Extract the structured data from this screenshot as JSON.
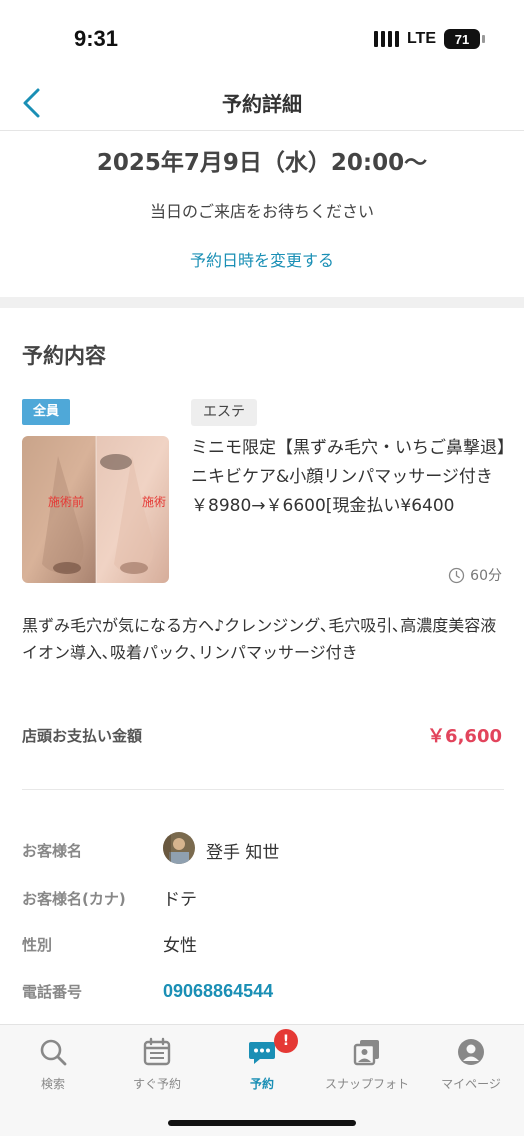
{
  "status_bar": {
    "time": "9:31",
    "network": "LTE",
    "battery": "71"
  },
  "nav": {
    "title": "予約詳細"
  },
  "reservation": {
    "date": "2025年7月9日（水）20:00〜",
    "message": "当日のご来店をお待ちください",
    "change_link": "予約日時を変更する"
  },
  "content": {
    "section_title": "予約内容",
    "tag_target": "全員",
    "tag_category": "エステ",
    "photo_labels": [
      "施術前",
      "施術"
    ],
    "menu_name": "ミニモ限定【黒ずみ毛穴・いちご鼻撃退】ニキビケア&小顔リンパマッサージ付き￥8980→￥6600[現金払い¥6400",
    "duration": "60分",
    "description": "黒ずみ毛穴が気になる方へ♪クレンジング､毛穴吸引､高濃度美容液イオン導入､吸着パック､リンパマッサージ付き",
    "payment_label": "店頭お支払い金額",
    "payment_value": "￥6,600"
  },
  "customer": {
    "name_label": "お客様名",
    "name_value": "登手 知世",
    "kana_label": "お客様名(カナ)",
    "kana_value": "ドテ",
    "gender_label": "性別",
    "gender_value": "女性",
    "phone_label": "電話番号",
    "phone_value": "09068864544"
  },
  "tabbar": {
    "items": [
      {
        "label": "検索",
        "icon": "search-icon"
      },
      {
        "label": "すぐ予約",
        "icon": "calendar-icon"
      },
      {
        "label": "予約",
        "icon": "chat-icon"
      },
      {
        "label": "スナップフォト",
        "icon": "photos-icon"
      },
      {
        "label": "マイページ",
        "icon": "user-icon"
      }
    ],
    "badge": "!"
  },
  "colors": {
    "accent": "#1a8fb5",
    "price": "#e2445c",
    "tag": "#4fa8d8",
    "badge": "#e53935"
  }
}
